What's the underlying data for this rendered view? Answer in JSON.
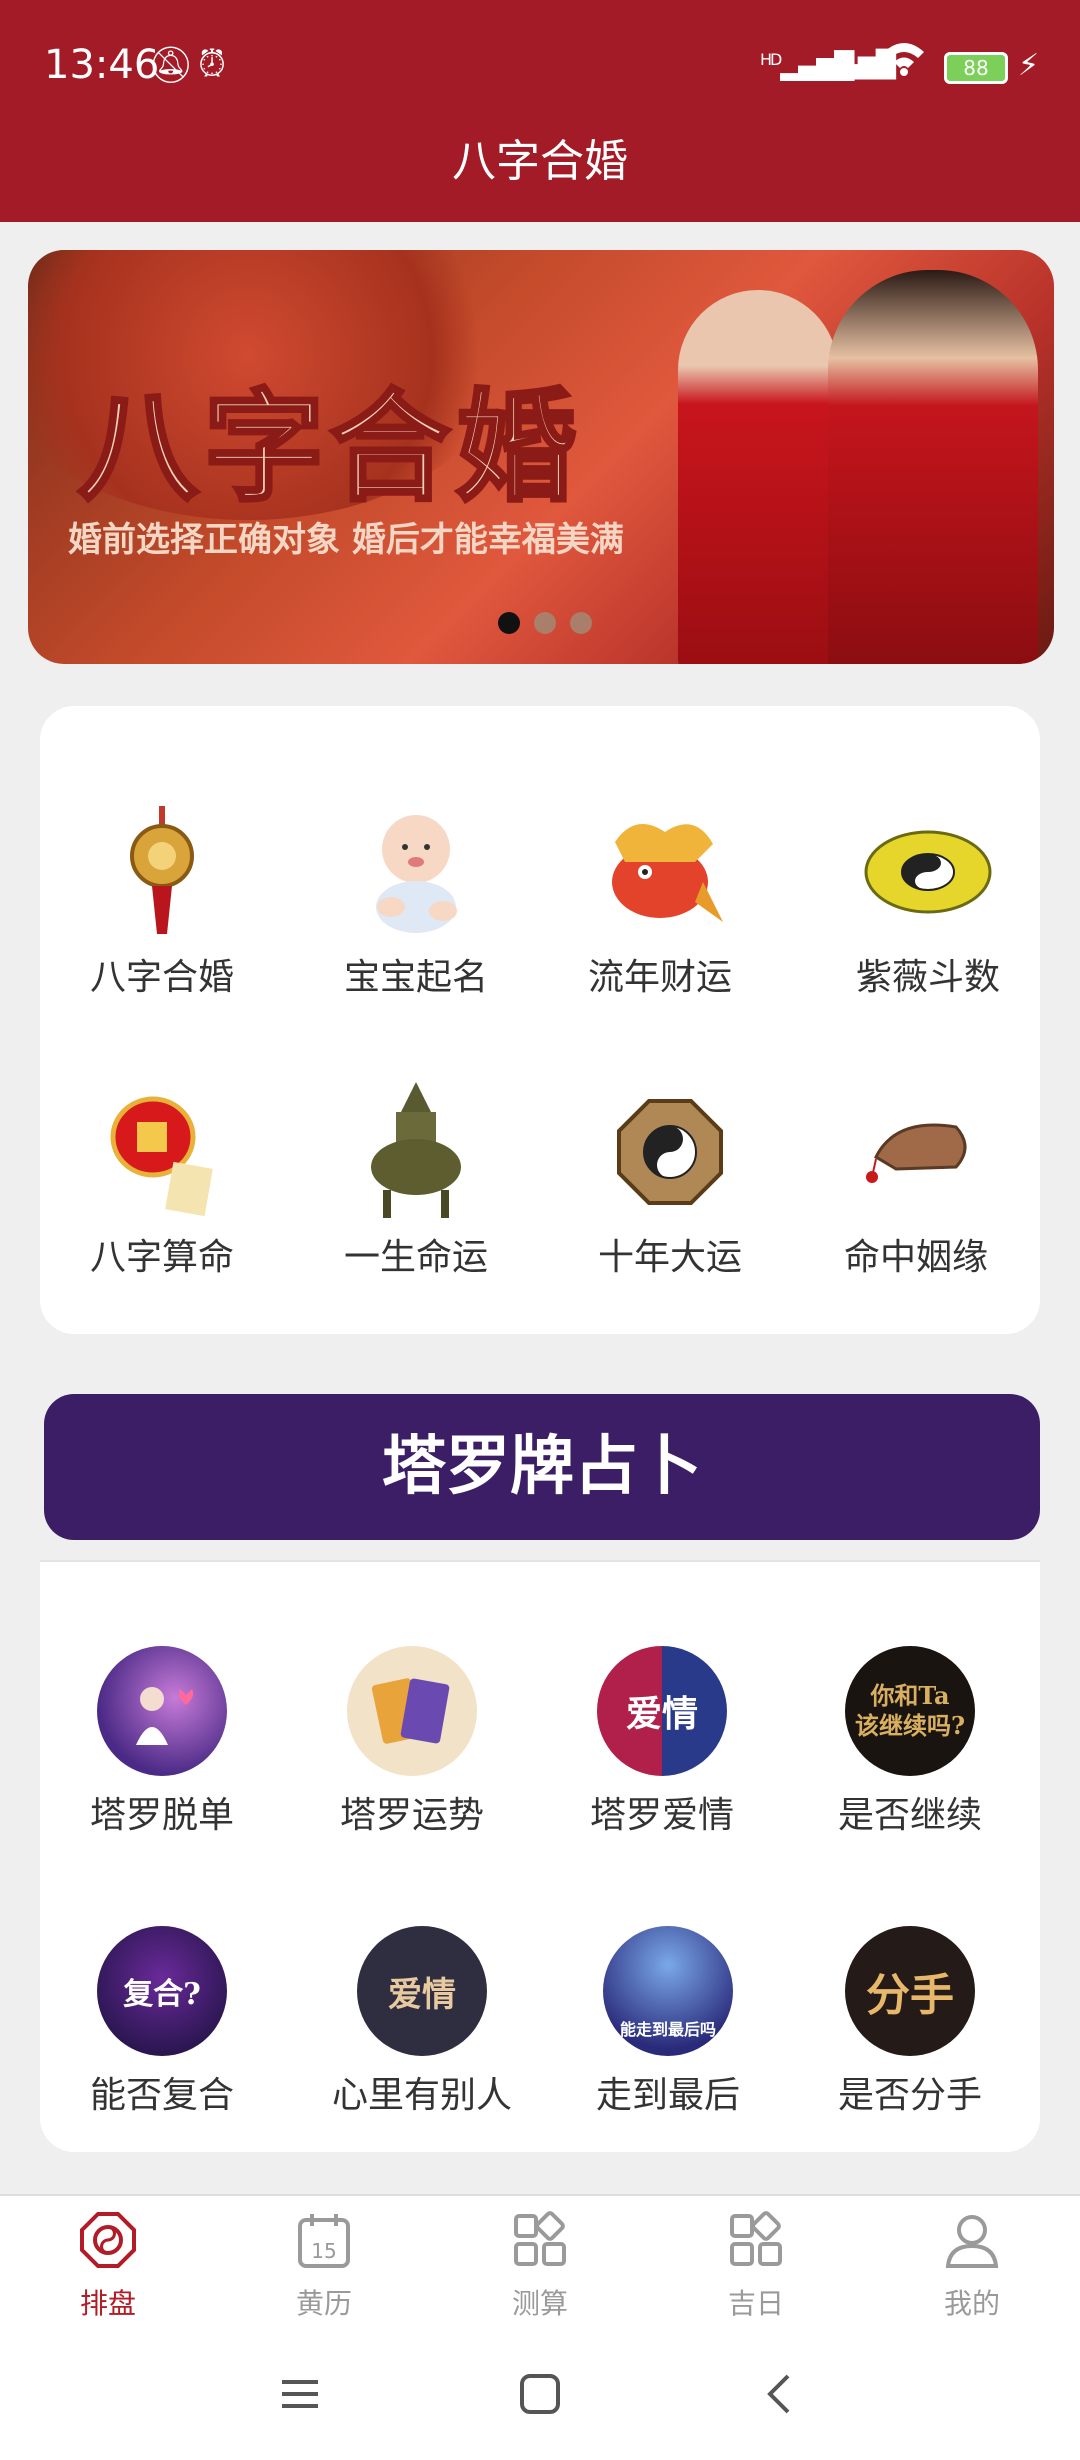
{
  "status_bar": {
    "time": "13:46",
    "battery": "88",
    "net_label": "HD"
  },
  "header": {
    "title": "八字合婚"
  },
  "banner": {
    "title": "八字合婚",
    "subtitle": "婚前选择正确对象 婚后才能幸福美满",
    "dots": 3,
    "active_dot": 0
  },
  "bazi_grid": {
    "items": [
      {
        "label": "八字合婚",
        "icon": "golden-pendant-icon"
      },
      {
        "label": "宝宝起名",
        "icon": "baby-icon"
      },
      {
        "label": "流年财运",
        "icon": "lucky-fish-icon"
      },
      {
        "label": "紫薇斗数",
        "icon": "yin-yang-disc-icon"
      },
      {
        "label": "八字算命",
        "icon": "red-lantern-icon"
      },
      {
        "label": "一生命运",
        "icon": "bronze-censer-icon"
      },
      {
        "label": "十年大运",
        "icon": "bagua-icon"
      },
      {
        "label": "命中姻缘",
        "icon": "embroidered-shoe-icon"
      }
    ]
  },
  "tarot": {
    "header": "塔罗牌占卜",
    "items": [
      {
        "label": "塔罗脱单",
        "icon": "girl-moon-icon"
      },
      {
        "label": "塔罗运势",
        "icon": "tarot-cards-icon"
      },
      {
        "label": "塔罗爱情",
        "icon": "love-cards-icon",
        "art": "爱情"
      },
      {
        "label": "是否继续",
        "icon": "continue-icon",
        "art": "你和Ta\n该继续吗?"
      },
      {
        "label": "能否复合",
        "icon": "reunion-icon",
        "art": "复合?"
      },
      {
        "label": "心里有别人",
        "icon": "love-card-pair-icon",
        "art": "爱情"
      },
      {
        "label": "走到最后",
        "icon": "couple-icon",
        "art": "能走到最后吗"
      },
      {
        "label": "是否分手",
        "icon": "breakup-icon",
        "art": "分手"
      }
    ]
  },
  "bottom_nav": {
    "items": [
      {
        "label": "排盘",
        "active": true
      },
      {
        "label": "黄历",
        "active": false,
        "day": "15"
      },
      {
        "label": "测算",
        "active": false
      },
      {
        "label": "吉日",
        "active": false
      },
      {
        "label": "我的",
        "active": false
      }
    ]
  },
  "colors": {
    "brand_red": "#a31b26",
    "tarot_purple": "#3c1e66",
    "nav_active": "#b21c26"
  }
}
